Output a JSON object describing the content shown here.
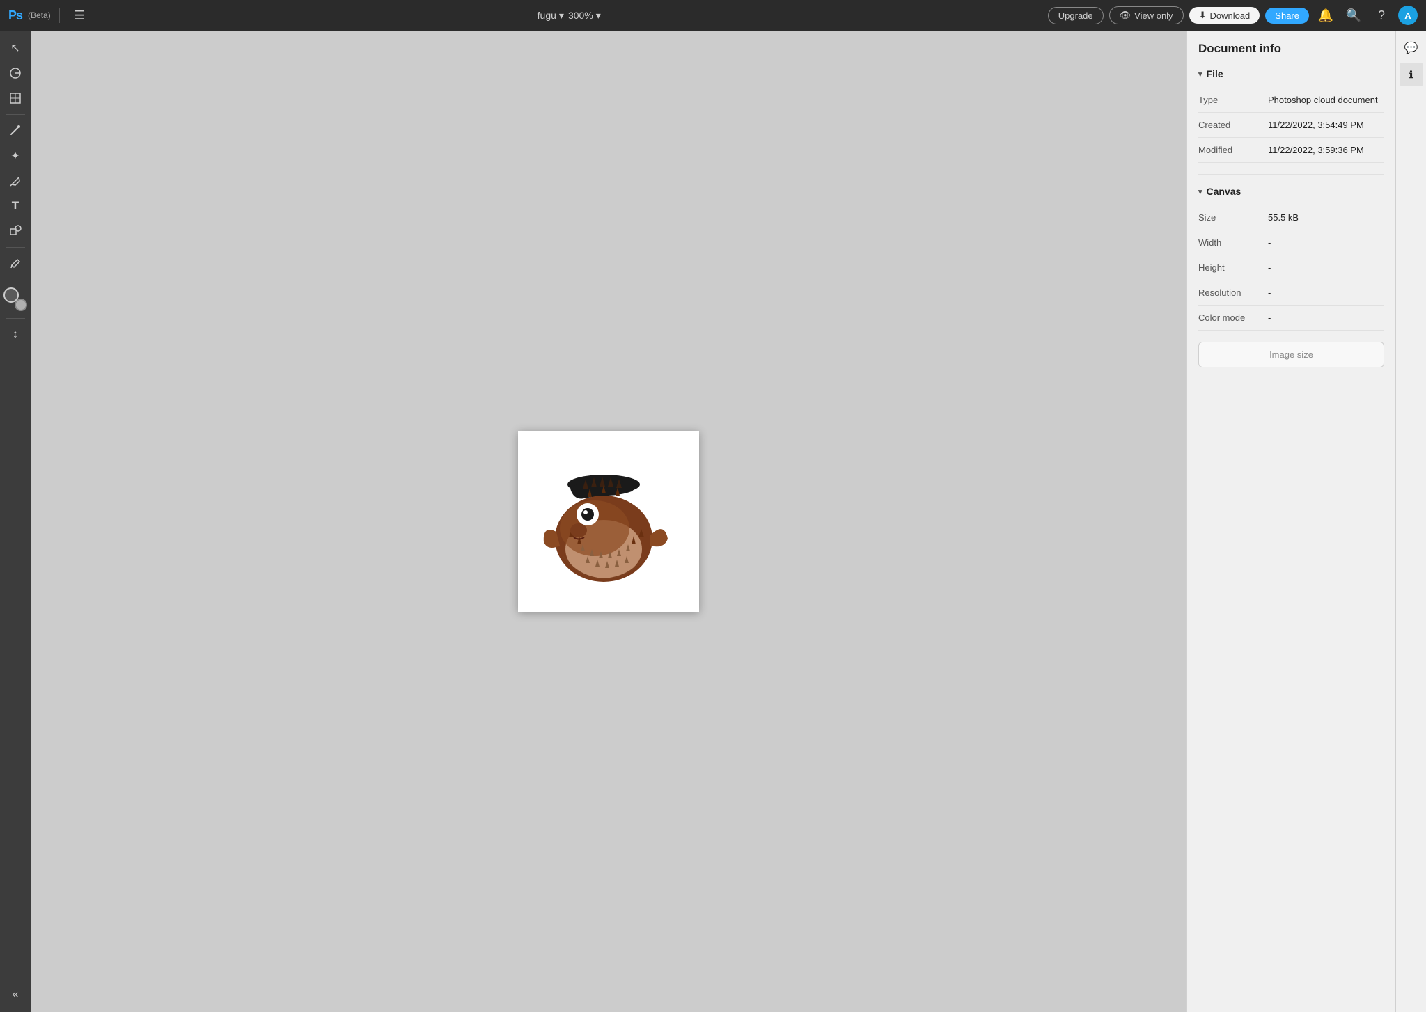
{
  "app": {
    "name": "Ps",
    "beta": "(Beta)"
  },
  "topbar": {
    "filename": "fugu",
    "zoom": "300%",
    "upgrade_label": "Upgrade",
    "view_only_label": "View only",
    "download_label": "Download",
    "share_label": "Share"
  },
  "toolbar": {
    "tools": [
      {
        "name": "select",
        "icon": "↖",
        "label": "Select tool"
      },
      {
        "name": "lasso",
        "icon": "⊙",
        "label": "Lasso tool"
      },
      {
        "name": "transform",
        "icon": "⊞",
        "label": "Transform tool"
      },
      {
        "name": "brush",
        "icon": "✏",
        "label": "Brush tool"
      },
      {
        "name": "heal",
        "icon": "✦",
        "label": "Heal tool"
      },
      {
        "name": "pen",
        "icon": "✒",
        "label": "Pen tool"
      },
      {
        "name": "type",
        "icon": "T",
        "label": "Type tool"
      },
      {
        "name": "shape",
        "icon": "❖",
        "label": "Shape tool"
      },
      {
        "name": "eyedropper",
        "icon": "⊘",
        "label": "Eyedropper tool"
      },
      {
        "name": "up-down",
        "icon": "↕",
        "label": "Swap"
      },
      {
        "name": "collapse",
        "icon": "«",
        "label": "Collapse"
      }
    ]
  },
  "document_info": {
    "title": "Document info",
    "sections": {
      "file": {
        "label": "File",
        "fields": [
          {
            "label": "Type",
            "value": "Photoshop cloud document"
          },
          {
            "label": "Created",
            "value": "11/22/2022, 3:54:49 PM"
          },
          {
            "label": "Modified",
            "value": "11/22/2022, 3:59:36 PM"
          }
        ]
      },
      "canvas": {
        "label": "Canvas",
        "fields": [
          {
            "label": "Size",
            "value": "55.5 kB"
          },
          {
            "label": "Width",
            "value": "-"
          },
          {
            "label": "Height",
            "value": "-"
          },
          {
            "label": "Resolution",
            "value": "-"
          },
          {
            "label": "Color mode",
            "value": "-"
          }
        ]
      }
    },
    "image_size_button": "Image size"
  },
  "right_icons": [
    {
      "name": "comment",
      "icon": "💬"
    },
    {
      "name": "info",
      "icon": "ℹ"
    }
  ],
  "colors": {
    "accent_blue": "#31a8ff",
    "topbar_bg": "#2b2b2b",
    "toolbar_bg": "#3c3c3c",
    "panel_bg": "#f0f0f0",
    "canvas_bg": "#cccccc"
  }
}
